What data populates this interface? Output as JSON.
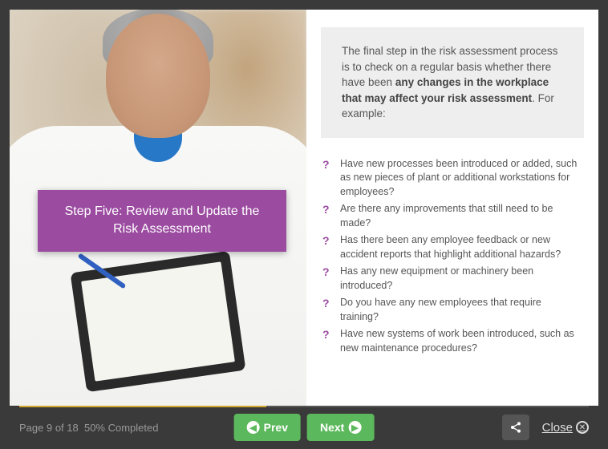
{
  "slide": {
    "title": "Step Five: Review and Update the Risk Assessment",
    "intro_pre": "The final step in the risk assessment process is to check on a regular basis whether there have been ",
    "intro_bold": "any changes in the workplace that may affect your risk assessment",
    "intro_post": ". For example:",
    "questions": [
      "Have new processes been introduced or added, such as new pieces of plant or additional workstations for employees?",
      "Are there any improvements that still need to be made?",
      "Has there been any employee feedback or new accident reports that highlight additional hazards?",
      "Has any new equipment or machinery been introduced?",
      "Do you have any new employees that require training?",
      "Have new systems of work been introduced, such as new maintenance procedures?"
    ]
  },
  "footer": {
    "page_text": "Page 9 of 18",
    "completion": "50% Completed",
    "prev_label": "Prev",
    "next_label": "Next",
    "close_label": "Close"
  }
}
